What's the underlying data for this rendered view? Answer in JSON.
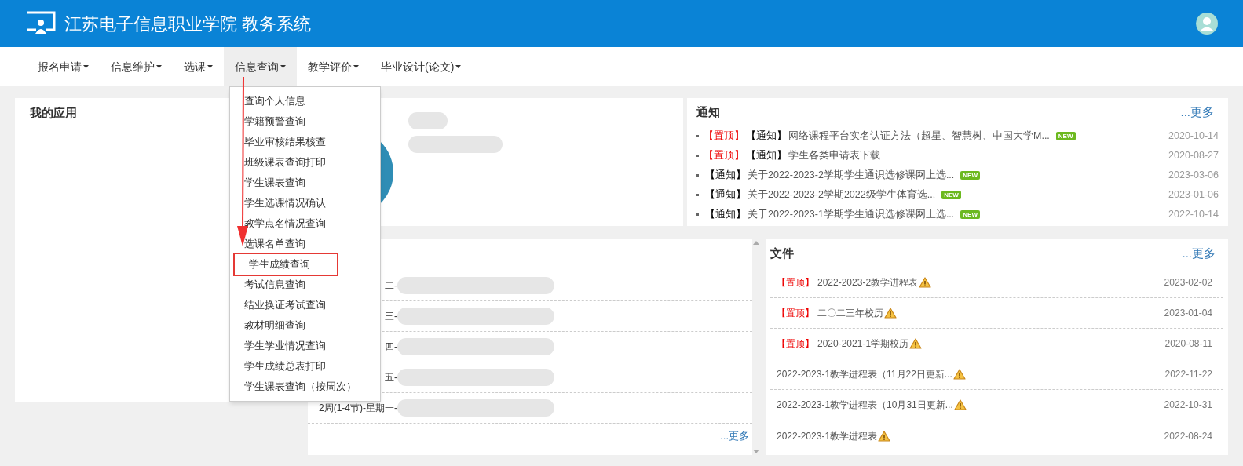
{
  "header": {
    "title": "江苏电子信息职业学院 教务系统"
  },
  "nav": [
    {
      "label": "报名申请",
      "selected": false
    },
    {
      "label": "信息维护",
      "selected": false
    },
    {
      "label": "选课",
      "selected": false
    },
    {
      "label": "信息查询",
      "selected": true
    },
    {
      "label": "教学评价",
      "selected": false
    },
    {
      "label": "毕业设计(论文)",
      "selected": false
    }
  ],
  "dropdown": [
    {
      "label": "查询个人信息",
      "selected": false
    },
    {
      "label": "学籍预警查询",
      "selected": false
    },
    {
      "label": "毕业审核结果核查",
      "selected": false
    },
    {
      "label": "班级课表查询打印",
      "selected": false
    },
    {
      "label": "学生课表查询",
      "selected": false
    },
    {
      "label": "学生选课情况确认",
      "selected": false
    },
    {
      "label": "教学点名情况查询",
      "selected": false
    },
    {
      "label": "选课名单查询",
      "selected": false
    },
    {
      "label": "学生成绩查询",
      "selected": true
    },
    {
      "label": "考试信息查询",
      "selected": false
    },
    {
      "label": "结业换证考试查询",
      "selected": false
    },
    {
      "label": "教材明细查询",
      "selected": false
    },
    {
      "label": "学生学业情况查询",
      "selected": false
    },
    {
      "label": "学生成绩总表打印",
      "selected": false
    },
    {
      "label": "学生课表查询（按周次）",
      "selected": false
    }
  ],
  "my_apps": {
    "title": "我的应用"
  },
  "schedule": {
    "rows": [
      "二-",
      "三-",
      "四-",
      "五-",
      "2周(1-4节)-星期一-"
    ],
    "more": "...更多"
  },
  "notices": {
    "title": "通知",
    "more": "...更多",
    "items": [
      {
        "pin": "【置顶】",
        "tag": "【通知】",
        "title": "网络课程平台实名认证方法（超星、智慧树、中国大学M...",
        "badge": "NEW",
        "date": "2020-10-14"
      },
      {
        "pin": "【置顶】",
        "tag": "【通知】",
        "title": "学生各类申请表下载",
        "date": "2020-08-27"
      },
      {
        "tag": "【通知】",
        "title": "关于2022-2023-2学期学生通识选修课网上选...",
        "badge": "NEW",
        "date": "2023-03-06"
      },
      {
        "tag": "【通知】",
        "title": "关于2022-2023-2学期2022级学生体育选...",
        "badge": "NEW",
        "date": "2023-01-06"
      },
      {
        "tag": "【通知】",
        "title": "关于2022-2023-1学期学生通识选修课网上选...",
        "badge": "NEW",
        "date": "2022-10-14"
      }
    ]
  },
  "files": {
    "title": "文件",
    "more": "...更多",
    "items": [
      {
        "pin": "【置顶】",
        "title": "2022-2023-2教学进程表",
        "date": "2023-02-02"
      },
      {
        "pin": "【置顶】",
        "title": "二〇二三年校历",
        "date": "2023-01-04"
      },
      {
        "pin": "【置顶】",
        "title": "2020-2021-1学期校历",
        "date": "2020-08-11"
      },
      {
        "title": "2022-2023-1教学进程表（11月22日更新...",
        "date": "2022-11-22"
      },
      {
        "title": "2022-2023-1教学进程表（10月31日更新...",
        "date": "2022-10-31"
      },
      {
        "title": "2022-2023-1教学进程表",
        "date": "2022-08-24"
      }
    ]
  }
}
